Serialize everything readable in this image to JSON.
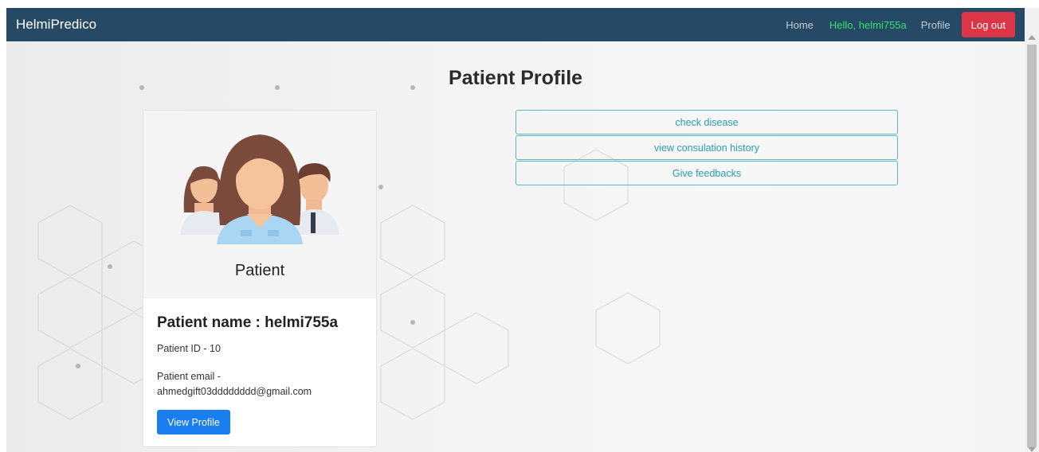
{
  "navbar": {
    "brand": "HelmiPredico",
    "home_label": "Home",
    "greeting": "Hello, helmi755a",
    "profile_label": "Profile",
    "logout_label": "Log out"
  },
  "page": {
    "title": "Patient Profile"
  },
  "profile_card": {
    "role_label": "Patient",
    "name_line": "Patient name : helmi755a",
    "id_line": "Patient ID - 10",
    "email_label": "Patient email -",
    "email_value": "ahmedgift03dddddddd@gmail.com",
    "view_profile_label": "View Profile"
  },
  "actions": [
    {
      "label": "check disease"
    },
    {
      "label": "view consulation history"
    },
    {
      "label": "Give feedbacks"
    }
  ],
  "colors": {
    "navbar_bg": "#264a66",
    "greeting": "#35e06a",
    "logout_bg": "#dc3545",
    "primary": "#1a7df0",
    "action_outline": "#5ab8c8"
  },
  "icons": {
    "avatar": "patients-group-illustration"
  }
}
